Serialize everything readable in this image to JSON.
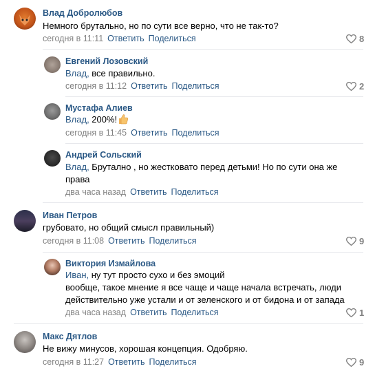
{
  "comments": [
    {
      "name": "Влад Добролюбов",
      "text": "Немного брутально, но по сути все верно, что не так-то?",
      "time": "сегодня в 11:11",
      "likes": "8",
      "avatar": "fox-avatar"
    },
    {
      "name": "Евгений Лозовский",
      "reply_to": "Влад,",
      "text": " все правильно.",
      "time": "сегодня в 11:12",
      "likes": "2",
      "avatar": "animal-avatar"
    },
    {
      "name": "Мустафа Алиев",
      "reply_to": "Влад,",
      "text": " 200%!",
      "time": "сегодня в 11:45",
      "likes": "",
      "avatar": "cat-avatar"
    },
    {
      "name": "Андрей Сольский",
      "reply_to": "Влад,",
      "text_line1": " Брутално , но жестковато перед детьми! Но по сути она же",
      "text_line2": "права",
      "time": "два часа назад",
      "likes": "",
      "avatar": "dark-avatar"
    },
    {
      "name": "Иван Петров",
      "text": "грубовато, но общий смысл правильный)",
      "time": "сегодня в 11:08",
      "likes": "9",
      "avatar": "poster-avatar"
    },
    {
      "name": "Виктория Измайлова",
      "reply_to": "Иван,",
      "text_line1": " ну тут просто сухо и без эмоций",
      "text_line2": "вообще, такое мнение я все чаще и чаще начала встречать, люди",
      "text_line3": "действительно уже устали и от зеленского и от бидона и от запада",
      "time": "два часа назад",
      "likes": "1",
      "avatar": "woman-avatar"
    },
    {
      "name": "Макс Дятлов",
      "text": "Не вижу минусов, хорошая концепция. Одобряю.",
      "time": "сегодня в 11:27",
      "likes": "9",
      "avatar": "man-avatar"
    }
  ],
  "actions": {
    "reply": "Ответить",
    "share": "Поделиться"
  },
  "colors": {
    "link": "#2a5885",
    "meta": "#828282",
    "divider": "#e7e8ec"
  }
}
